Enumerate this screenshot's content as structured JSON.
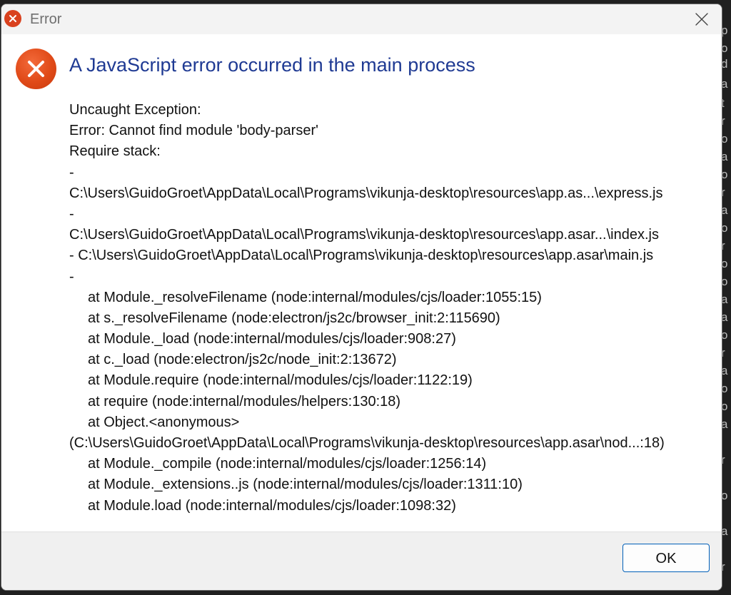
{
  "background": {
    "letters": [
      "p",
      "d",
      "t",
      "o",
      "o",
      "a",
      "r",
      "o",
      "a",
      "r",
      "o",
      "a",
      "r",
      "o",
      "a",
      "r",
      "o",
      "a",
      "r",
      "a",
      "r",
      "o",
      "o",
      "a",
      "o",
      "a",
      "o"
    ]
  },
  "window": {
    "title": "Error",
    "title_icon": "error-icon",
    "close_icon": "close-icon"
  },
  "dialog": {
    "icon": "error-circle-icon",
    "heading": "A JavaScript error occurred in the main process",
    "message_lines": [
      "Uncaught Exception:",
      "Error: Cannot find module 'body-parser'",
      "Require stack:",
      "-",
      "C:\\Users\\GuidoGroet\\AppData\\Local\\Programs\\vikunja-desktop\\resources\\app.as...\\express.js",
      "-",
      "C:\\Users\\GuidoGroet\\AppData\\Local\\Programs\\vikunja-desktop\\resources\\app.asar...\\index.js",
      "- C:\\Users\\GuidoGroet\\AppData\\Local\\Programs\\vikunja-desktop\\resources\\app.asar\\main.js",
      "-",
      "at Module._resolveFilename (node:internal/modules/cjs/loader:1055:15)",
      "at s._resolveFilename (node:electron/js2c/browser_init:2:115690)",
      "at Module._load (node:internal/modules/cjs/loader:908:27)",
      "at c._load (node:electron/js2c/node_init:2:13672)",
      "at Module.require (node:internal/modules/cjs/loader:1122:19)",
      "at require (node:internal/modules/helpers:130:18)",
      "at Object.<anonymous>",
      "(C:\\Users\\GuidoGroet\\AppData\\Local\\Programs\\vikunja-desktop\\resources\\app.asar\\nod...:18)",
      "at Module._compile (node:internal/modules/cjs/loader:1256:14)",
      "at Module._extensions..js (node:internal/modules/cjs/loader:1311:10)",
      "at Module.load (node:internal/modules/cjs/loader:1098:32)"
    ]
  },
  "footer": {
    "ok_label": "OK"
  },
  "colors": {
    "heading": "#1f3a93",
    "error_icon": "#e04a18",
    "ok_border": "#005fb8"
  }
}
